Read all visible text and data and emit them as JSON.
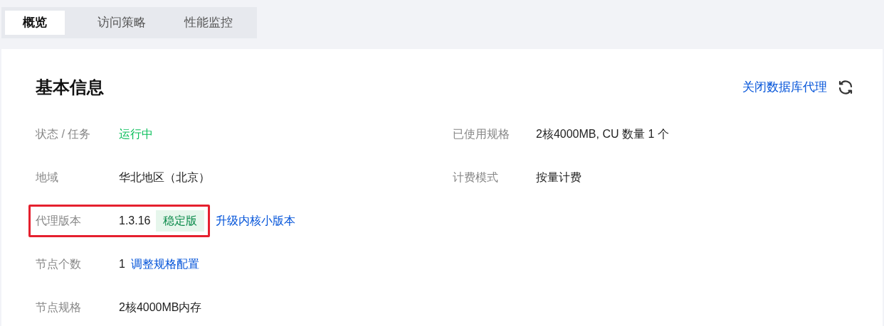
{
  "tabs": [
    {
      "label": "概览",
      "selected": true
    },
    {
      "label": "访问策略",
      "selected": false
    },
    {
      "label": "性能监控",
      "selected": false
    }
  ],
  "section": {
    "title": "基本信息",
    "action_link": "关闭数据库代理"
  },
  "left_fields": [
    {
      "label": "状态 / 任务",
      "highlighted": false,
      "parts": [
        {
          "kind": "status",
          "text": "运行中"
        }
      ]
    },
    {
      "label": "地域",
      "highlighted": false,
      "parts": [
        {
          "kind": "text",
          "text": "华北地区（北京）"
        }
      ]
    },
    {
      "label": "代理版本",
      "highlighted": true,
      "parts": [
        {
          "kind": "text",
          "text": "1.3.16"
        },
        {
          "kind": "tag",
          "text": "稳定版"
        },
        {
          "kind": "link",
          "text": "升级内核小版本"
        }
      ]
    },
    {
      "label": "节点个数",
      "highlighted": false,
      "parts": [
        {
          "kind": "text",
          "text": "1"
        },
        {
          "kind": "link",
          "text": "调整规格配置"
        }
      ]
    },
    {
      "label": "节点规格",
      "highlighted": false,
      "parts": [
        {
          "kind": "text",
          "text": "2核4000MB内存"
        }
      ]
    }
  ],
  "right_fields": [
    {
      "label": "已使用规格",
      "highlighted": false,
      "parts": [
        {
          "kind": "text",
          "text": "2核4000MB, CU 数量 1 个"
        }
      ]
    },
    {
      "label": "计费模式",
      "highlighted": false,
      "parts": [
        {
          "kind": "text",
          "text": "按量计费"
        }
      ]
    }
  ]
}
